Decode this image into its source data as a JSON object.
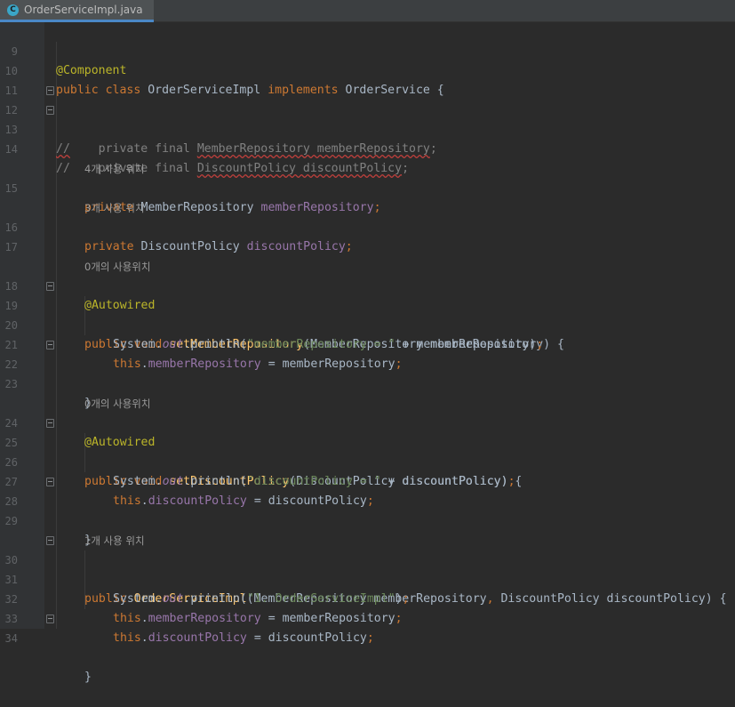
{
  "tab": {
    "icon_letter": "C",
    "filename": "OrderServiceImpl.java"
  },
  "hints": {
    "h15": "4개 사용 위치",
    "h16": "3개 사용 위치",
    "h18": "0개의 사용위치",
    "h24": "0개의 사용위치",
    "h30": "1개 사용 위치"
  },
  "code": {
    "l9": {
      "num": "9",
      "ann": "@Component"
    },
    "l10": {
      "num": "10",
      "kw1": "public class ",
      "cls": "OrderServiceImpl ",
      "kw2": "implements ",
      "iface": "OrderService {"
    },
    "l11": {
      "num": "11"
    },
    "l12": {
      "num": "12",
      "cm": "//",
      "rest": "    private final ",
      "t": "MemberRepository memberRepository",
      "end": ";"
    },
    "l13": {
      "num": "13",
      "cm": "//",
      "rest": "    private final ",
      "t": "DiscountPolicy discountPolicy",
      "end": ";"
    },
    "l14": {
      "num": "14"
    },
    "l15": {
      "num": "15",
      "kw": "private ",
      "type": "MemberRepository ",
      "field": "memberRepository",
      "semi": ";"
    },
    "l16": {
      "num": "16",
      "kw": "private ",
      "type": "DiscountPolicy ",
      "field": "discountPolicy",
      "semi": ";"
    },
    "l17": {
      "num": "17"
    },
    "l18": {
      "num": "18",
      "ann": "@Autowired"
    },
    "l19": {
      "num": "19",
      "kw": "public void ",
      "method": "setMemberRepository",
      "rest": "(MemberRepository memberRepository) {"
    },
    "l20": {
      "num": "20",
      "pre": "System.",
      "out": "out",
      "mid": ".println(",
      "str": "\"memberRepository = \"",
      "post": " + memberRepository)",
      "semi": ";"
    },
    "l21": {
      "num": "21",
      "kw": "this",
      "dot": ".",
      "field": "memberRepository",
      "rest": " = memberRepository",
      "semi": ";"
    },
    "l22": {
      "num": "22"
    },
    "l23": {
      "num": "23"
    },
    "l24": {
      "num": "24",
      "ann": "@Autowired"
    },
    "l25": {
      "num": "25",
      "kw": "public void ",
      "method": "setDiscountPolicy",
      "rest": "(DiscountPolicy discountPolicy) {"
    },
    "l26": {
      "num": "26",
      "pre": "System.",
      "out": "out",
      "mid": ".println(",
      "str": "\"discountPolicy = \"",
      "post": " + discountPolicy)",
      "semi": ";"
    },
    "l27": {
      "num": "27",
      "kw": "this",
      "dot": ".",
      "field": "discountPolicy",
      "rest": " = discountPolicy",
      "semi": ";"
    },
    "l28": {
      "num": "28"
    },
    "l29": {
      "num": "29"
    },
    "l30": {
      "num": "30",
      "kw": "public ",
      "method": "OrderServiceImpl",
      "p1": "(MemberRepository memberRepository",
      "comma": ", ",
      "p2": "DiscountPolicy discountPolicy) {"
    },
    "l31": {
      "num": "31",
      "pre": "System.",
      "out": "out",
      "mid": ".println(",
      "str": "\"1. OrderServiceImpl\"",
      "post": ")",
      "semi": ";"
    },
    "l32": {
      "num": "32",
      "kw": "this",
      "dot": ".",
      "field": "memberRepository",
      "rest": " = memberRepository",
      "semi": ";"
    },
    "l33": {
      "num": "33",
      "kw": "this",
      "dot": ".",
      "field": "discountPolicy",
      "rest": " = discountPolicy",
      "semi": ";"
    },
    "l34": {
      "num": "34"
    },
    "brace": "}"
  }
}
